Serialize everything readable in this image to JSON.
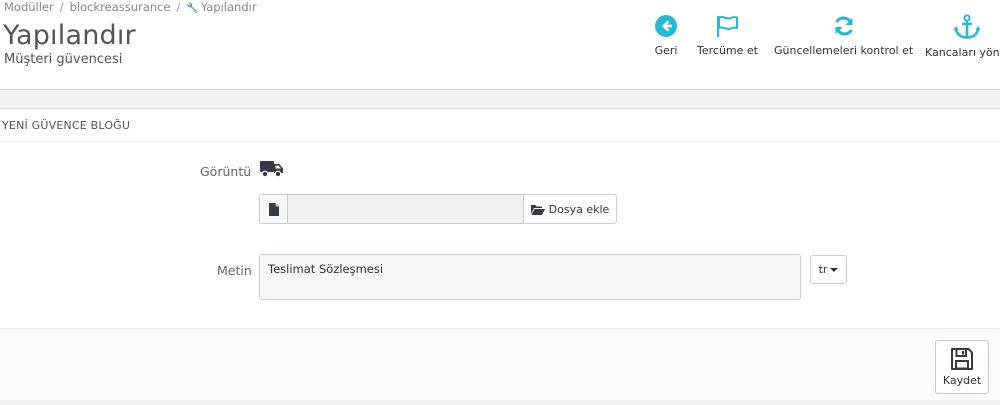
{
  "breadcrumb": {
    "items": [
      "Modüller",
      "blockreassurance",
      "Yapılandır"
    ],
    "separator": "/"
  },
  "header": {
    "title": "Yapılandır",
    "subtitle": "Müşteri güvencesi"
  },
  "toolbar": {
    "back_label": "Geri",
    "translate_label": "Tercüme et",
    "check_updates_label": "Güncellemeleri kontrol et",
    "hooks_label": "Kancaları yöne"
  },
  "panel": {
    "heading": "YENİ GÜVENCE BLOĞU",
    "image_label": "Görüntü",
    "file_button_label": "Dosya ekle",
    "file_name": "",
    "text_label": "Metin",
    "text_value": "Teslimat Sözleşmesi",
    "language": "tr",
    "save_label": "Kaydet"
  },
  "colors": {
    "accent": "#25b9d7",
    "icon_dark": "#363a41"
  }
}
